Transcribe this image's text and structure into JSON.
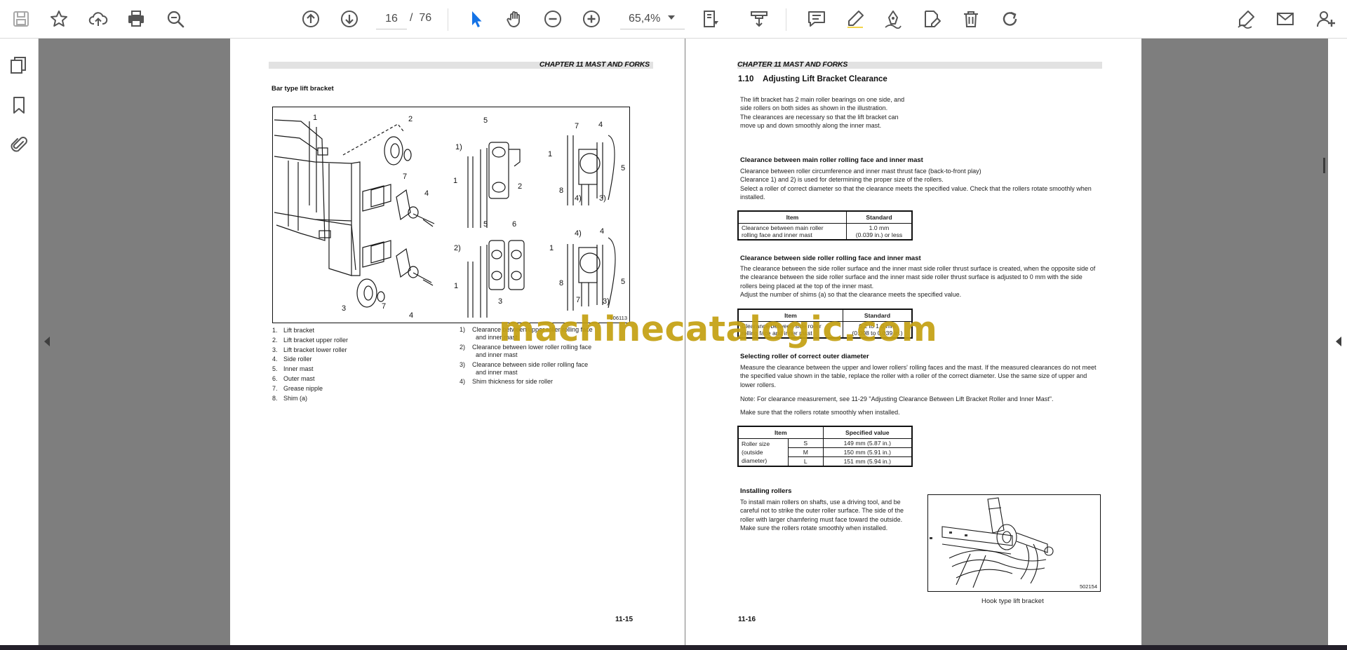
{
  "toolbar": {
    "current_page": "16",
    "page_separator": "/",
    "total_pages": "76",
    "zoom": "65,4%"
  },
  "colors": {
    "doc_background": "#7e7e7e",
    "active_tool": "#1473e6",
    "watermark": "#c4a012"
  },
  "icons": {
    "toolbar": [
      "save-icon",
      "bookmark-star-icon",
      "upload-cloud-icon",
      "print-icon",
      "zoom-search-icon",
      "page-up-icon",
      "page-down-icon",
      "select-cursor-icon",
      "hand-tool-icon",
      "zoom-out-icon",
      "zoom-in-icon",
      "page-fit-icon",
      "scroll-mode-icon",
      "comment-icon",
      "highlight-pen-icon",
      "draw-icon",
      "edit-stamp-icon",
      "trash-icon",
      "redo-icon",
      "sign-icon",
      "email-icon",
      "add-user-icon"
    ],
    "rail": [
      "page-thumbnails-icon",
      "bookmark-icon",
      "attachment-icon"
    ]
  },
  "left_page": {
    "chapter_header": "CHAPTER 11 MAST AND FORKS",
    "section_title": "Bar type lift bracket",
    "figure_id": "506113",
    "callout_labels": [
      "1",
      "2",
      "3",
      "4",
      "5",
      "6",
      "7",
      "8",
      "1)",
      "2)",
      "3)",
      "4)"
    ],
    "legend_numbered": [
      {
        "n": "1.",
        "text": "Lift bracket"
      },
      {
        "n": "2.",
        "text": "Lift bracket upper roller"
      },
      {
        "n": "3.",
        "text": "Lift bracket lower roller"
      },
      {
        "n": "4.",
        "text": "Side roller"
      },
      {
        "n": "5.",
        "text": "Inner mast"
      },
      {
        "n": "6.",
        "text": "Outer mast"
      },
      {
        "n": "7.",
        "text": "Grease nipple"
      },
      {
        "n": "8.",
        "text": "Shim (a)"
      }
    ],
    "legend_paren": [
      {
        "n": "1)",
        "line1": "Clearance between upper roller rolling face",
        "line2": "and inner mast"
      },
      {
        "n": "2)",
        "line1": "Clearance between lower roller rolling face",
        "line2": "and inner mast"
      },
      {
        "n": "3)",
        "line1": "Clearance between side roller rolling face",
        "line2": "and inner mast"
      },
      {
        "n": "4)",
        "line1": "Shim thickness for side roller",
        "line2": ""
      }
    ],
    "page_number": "11-15"
  },
  "right_page": {
    "chapter_header": "CHAPTER 11 MAST AND FORKS",
    "section_number": "1.10",
    "section_title": "Adjusting Lift Bracket Clearance",
    "intro": [
      "The lift bracket has 2 main roller bearings on one side, and",
      "side rollers on both sides as shown in the illustration.",
      "The clearances are necessary so that the lift bracket can",
      "move up and down smoothly along the inner mast."
    ],
    "main_roller": {
      "heading": "Clearance between main roller rolling face and inner mast",
      "lines": [
        "Clearance between roller circumference and inner mast thrust face (back-to-front play)",
        "Clearance 1) and 2) is used for determining the proper size of the rollers.",
        "Select a roller of correct diameter so that the clearance meets the specified value. Check that the rollers rotate smoothly when",
        "installed."
      ],
      "table": {
        "col_item": "Item",
        "col_standard": "Standard",
        "item_line1": "Clearance between main roller",
        "item_line2": "rolling face and inner mast",
        "standard_line1": "1.0 mm",
        "standard_line2": "(0.039 in.) or less"
      }
    },
    "side_roller": {
      "heading": "Clearance between side roller rolling face and inner mast",
      "lines": [
        "The clearance between the side roller surface and the inner mast side roller thrust surface is created, when the opposite side of",
        "the clearance between the side roller surface and the inner mast side roller thrust surface is adjusted to 0 mm with the side",
        "rollers being placed at the top of the inner mast.",
        "Adjust the number of shims (a) so that the clearance meets the specified value."
      ],
      "table": {
        "col_item": "Item",
        "col_standard": "Standard",
        "item_line1": "Clearance between side roller",
        "item_line2": "rolling face and inner mast",
        "standard_line1": "0.2 to 1.0 mm",
        "standard_line2": "(0.008 to 0.039 in.)"
      }
    },
    "outer_diameter": {
      "heading": "Selecting roller of correct outer diameter",
      "lines": [
        "Measure the clearance between the upper and lower rollers' rolling faces and the mast. If the measured clearances do not meet",
        "the specified value shown in the table, replace the roller with a roller of the correct diameter. Use the same size of upper and",
        "lower rollers."
      ],
      "note": "Note: For clearance measurement, see 11-29 \"Adjusting Clearance Between Lift Bracket Roller and Inner Mast\".",
      "check": "Make sure that the rollers rotate smoothly when installed.",
      "table": {
        "col_item": "Item",
        "col_value": "Specified value",
        "item_line1": "Roller size",
        "item_line2": "(outside",
        "item_line3": "diameter)",
        "rows": [
          {
            "size": "S",
            "value": "149 mm (5.87 in.)"
          },
          {
            "size": "M",
            "value": "150 mm (5.91 in.)"
          },
          {
            "size": "L",
            "value": "151 mm (5.94 in.)"
          }
        ]
      }
    },
    "installing": {
      "heading": "Installing rollers",
      "lines": [
        "To install main rollers on shafts, use a driving tool, and be",
        "careful not to strike the outer roller surface. The side of the",
        "roller with larger chamfering must face toward the outside.",
        "Make sure the rollers rotate smoothly when installed."
      ]
    },
    "figure_id": "502154",
    "figure_caption": "Hook type lift bracket",
    "page_number": "11-16"
  },
  "watermark": "machinecatalogic.com"
}
